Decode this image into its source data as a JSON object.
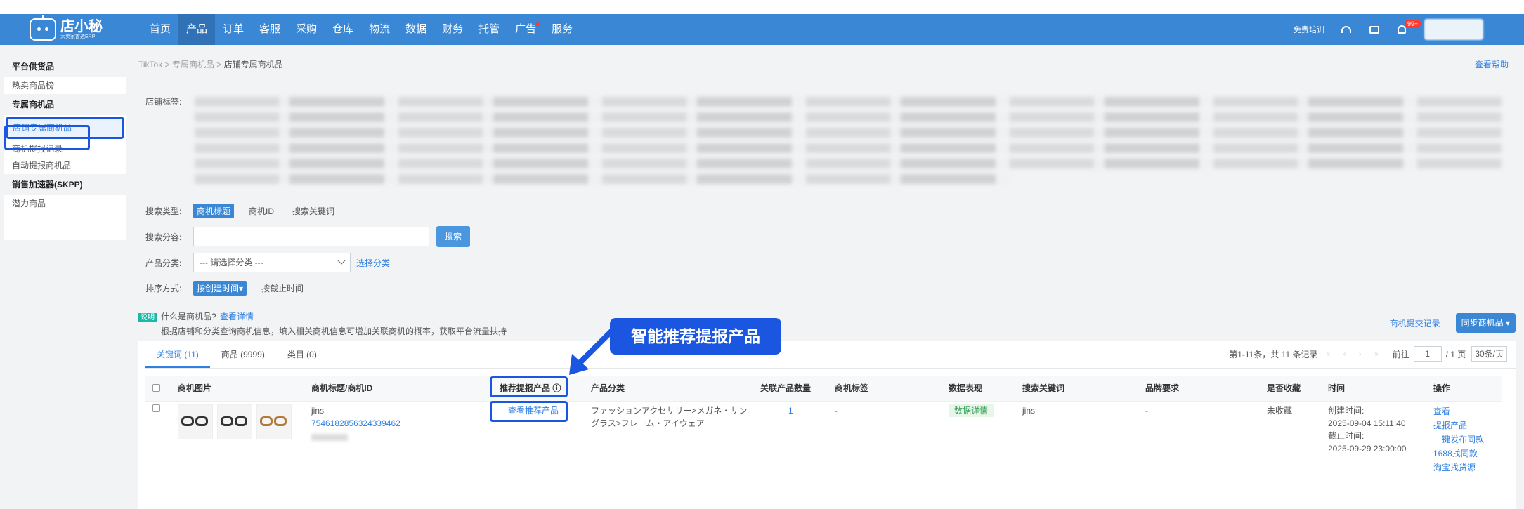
{
  "nav": {
    "logo_main": "店小秘",
    "logo_sub": "大卖家首选ERP",
    "items": [
      {
        "label": "首页"
      },
      {
        "label": "产品"
      },
      {
        "label": "订单"
      },
      {
        "label": "客服"
      },
      {
        "label": "采购"
      },
      {
        "label": "仓库"
      },
      {
        "label": "物流"
      },
      {
        "label": "数据"
      },
      {
        "label": "财务"
      },
      {
        "label": "托管"
      },
      {
        "label": "广告"
      },
      {
        "label": "服务"
      }
    ],
    "free_training": "免费培训",
    "badge": "99+"
  },
  "sidebar": {
    "sections": [
      {
        "title": "平台供货品",
        "items": [
          "热卖商品榜"
        ]
      },
      {
        "title": "专属商机品",
        "items": [
          "店铺专属商机品",
          "商机提报记录",
          "自动提报商机品"
        ]
      },
      {
        "title": "销售加速器(SKPP)",
        "items": [
          "潜力商品"
        ]
      }
    ]
  },
  "breadcrumb": {
    "a": "TikTok",
    "b": "专属商机品",
    "c": "店铺专属商机品",
    "sep": ">"
  },
  "help": "查看帮助",
  "filters": {
    "tags_label": "店铺标签:",
    "search_type_label": "搜索类型:",
    "search_types": [
      "商机标题",
      "商机ID",
      "搜索关键词"
    ],
    "search_content_label": "搜索分容:",
    "search_btn": "搜索",
    "category_label": "产品分类:",
    "category_placeholder": "--- 请选择分类 ---",
    "choose_category": "选择分类",
    "sort_label": "排序方式:",
    "sort_options": [
      "按创建时间▾",
      "按截止时间"
    ]
  },
  "info": {
    "badge": "说明",
    "q": "什么是商机品?",
    "detail": "查看详情",
    "desc": "根据店铺和分类查询商机信息，填入相关商机信息可增加关联商机的概率，获取平台流量扶持"
  },
  "actions": {
    "record": "商机提交记录",
    "sync": "同步商机品"
  },
  "tabs": [
    {
      "label": "关键词 (11)"
    },
    {
      "label": "商品 (9999)"
    },
    {
      "label": "类目 (0)"
    }
  ],
  "pager": {
    "summary": "第1-11条，共 11 条记录",
    "arrows": "« ‹ › »",
    "goto": "前往",
    "page": "1",
    "total": "/ 1 页",
    "size": "30条/页"
  },
  "table": {
    "headers": [
      "商机图片",
      "商机标题/商机ID",
      "推荐提报产品 ⓘ",
      "产品分类",
      "关联产品数量",
      "商机标签",
      "数据表现",
      "搜索关键词",
      "品牌要求",
      "是否收藏",
      "时间",
      "操作"
    ],
    "row": {
      "title": "jins",
      "id": "7546182856324339462",
      "recommend": "查看推荐产品",
      "category": "ファッションアクセサリー>メガネ・サングラス>フレーム・アイウェア",
      "count": "1",
      "tag": "-",
      "performance": "数据详情",
      "keyword": "jins",
      "brand": "-",
      "favorite": "未收藏",
      "created_label": "创建时间:",
      "created": "2025-09-04 15:11:40",
      "deadline_label": "截止时间:",
      "deadline": "2025-09-29 23:00:00",
      "ops": [
        "查看",
        "提报产品",
        "一键发布同款",
        "1688找同款",
        "淘宝找货源"
      ]
    }
  },
  "callout": "智能推荐提报产品",
  "colors": {
    "nav": "#3a87d6",
    "accent": "#2f7fe0",
    "highlight": "#1a56e0"
  }
}
